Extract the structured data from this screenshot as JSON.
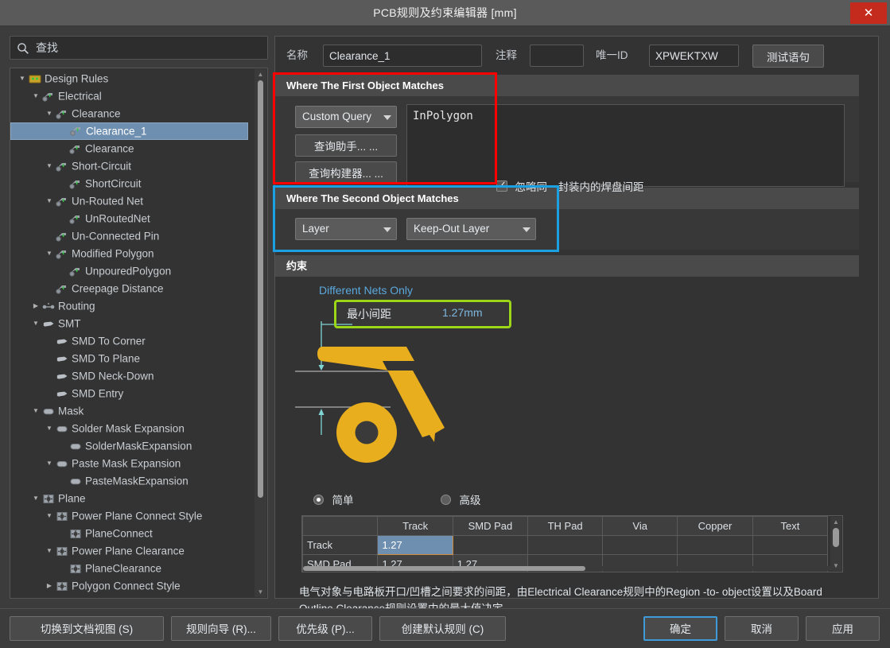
{
  "window": {
    "title": "PCB规则及约束编辑器 [mm]",
    "close_label": "✕"
  },
  "search": {
    "placeholder": "查找",
    "value": "",
    "icon": "search-icon"
  },
  "tree": {
    "items": [
      {
        "label": "Design Rules",
        "indent": 0,
        "arrow": "down",
        "icon": "folder-rules-icon",
        "selected": false
      },
      {
        "label": "Electrical",
        "indent": 1,
        "arrow": "down",
        "icon": "electrical-icon",
        "selected": false
      },
      {
        "label": "Clearance",
        "indent": 2,
        "arrow": "down",
        "icon": "electrical-icon",
        "selected": false
      },
      {
        "label": "Clearance_1",
        "indent": 3,
        "arrow": "none",
        "icon": "electrical-icon",
        "selected": true
      },
      {
        "label": "Clearance",
        "indent": 3,
        "arrow": "none",
        "icon": "electrical-icon",
        "selected": false
      },
      {
        "label": "Short-Circuit",
        "indent": 2,
        "arrow": "down",
        "icon": "electrical-icon",
        "selected": false
      },
      {
        "label": "ShortCircuit",
        "indent": 3,
        "arrow": "none",
        "icon": "electrical-icon",
        "selected": false
      },
      {
        "label": "Un-Routed Net",
        "indent": 2,
        "arrow": "down",
        "icon": "electrical-icon",
        "selected": false
      },
      {
        "label": "UnRoutedNet",
        "indent": 3,
        "arrow": "none",
        "icon": "electrical-icon",
        "selected": false
      },
      {
        "label": "Un-Connected Pin",
        "indent": 2,
        "arrow": "none",
        "icon": "electrical-icon",
        "selected": false
      },
      {
        "label": "Modified Polygon",
        "indent": 2,
        "arrow": "down",
        "icon": "electrical-icon",
        "selected": false
      },
      {
        "label": "UnpouredPolygon",
        "indent": 3,
        "arrow": "none",
        "icon": "electrical-icon",
        "selected": false
      },
      {
        "label": "Creepage Distance",
        "indent": 2,
        "arrow": "none",
        "icon": "electrical-icon",
        "selected": false
      },
      {
        "label": "Routing",
        "indent": 1,
        "arrow": "right",
        "icon": "routing-icon",
        "selected": false
      },
      {
        "label": "SMT",
        "indent": 1,
        "arrow": "down",
        "icon": "smt-icon",
        "selected": false
      },
      {
        "label": "SMD To Corner",
        "indent": 2,
        "arrow": "none",
        "icon": "smt-icon",
        "selected": false
      },
      {
        "label": "SMD To Plane",
        "indent": 2,
        "arrow": "none",
        "icon": "smt-icon",
        "selected": false
      },
      {
        "label": "SMD Neck-Down",
        "indent": 2,
        "arrow": "none",
        "icon": "smt-icon",
        "selected": false
      },
      {
        "label": "SMD Entry",
        "indent": 2,
        "arrow": "none",
        "icon": "smt-icon",
        "selected": false
      },
      {
        "label": "Mask",
        "indent": 1,
        "arrow": "down",
        "icon": "mask-icon",
        "selected": false
      },
      {
        "label": "Solder Mask Expansion",
        "indent": 2,
        "arrow": "down",
        "icon": "mask-icon",
        "selected": false
      },
      {
        "label": "SolderMaskExpansion",
        "indent": 3,
        "arrow": "none",
        "icon": "mask-icon",
        "selected": false
      },
      {
        "label": "Paste Mask Expansion",
        "indent": 2,
        "arrow": "down",
        "icon": "mask-icon",
        "selected": false
      },
      {
        "label": "PasteMaskExpansion",
        "indent": 3,
        "arrow": "none",
        "icon": "mask-icon",
        "selected": false
      },
      {
        "label": "Plane",
        "indent": 1,
        "arrow": "down",
        "icon": "plane-icon",
        "selected": false
      },
      {
        "label": "Power Plane Connect Style",
        "indent": 2,
        "arrow": "down",
        "icon": "plane-icon",
        "selected": false
      },
      {
        "label": "PlaneConnect",
        "indent": 3,
        "arrow": "none",
        "icon": "plane-icon",
        "selected": false
      },
      {
        "label": "Power Plane Clearance",
        "indent": 2,
        "arrow": "down",
        "icon": "plane-icon",
        "selected": false
      },
      {
        "label": "PlaneClearance",
        "indent": 3,
        "arrow": "none",
        "icon": "plane-icon",
        "selected": false
      },
      {
        "label": "Polygon Connect Style",
        "indent": 2,
        "arrow": "right",
        "icon": "plane-icon",
        "selected": false
      }
    ]
  },
  "rule_header": {
    "name_label": "名称",
    "name_value": "Clearance_1",
    "comment_label": "注释",
    "comment_value": "",
    "unique_id_label": "唯一ID",
    "unique_id_value": "XPWEKTXW",
    "test_query_button": "测试语句"
  },
  "first_object": {
    "section_title": "Where The First Object Matches",
    "scope_combo": "Custom Query",
    "query_helper_button": "查询助手... ...",
    "query_builder_button": "查询构建器... ...",
    "query_text": "InPolygon"
  },
  "second_object": {
    "section_title": "Where The Second Object Matches",
    "scope_combo": "Layer",
    "layer_combo": "Keep-Out Layer"
  },
  "constraints": {
    "section_title": "约束",
    "nets_scope_label": "Different Nets Only",
    "min_clearance_label": "最小间距",
    "min_clearance_value": "1.27mm",
    "ignore_pad_checkbox_label": "忽略同一封装内的焊盘间距",
    "ignore_pad_checked": true,
    "mode_simple_label": "简单",
    "mode_advanced_label": "高级",
    "mode_selected": "简单"
  },
  "matrix": {
    "columns": [
      "",
      "Track",
      "SMD Pad",
      "TH Pad",
      "Via",
      "Copper",
      "Text"
    ],
    "rows": [
      {
        "header": "Track",
        "cells": [
          "1.27",
          "",
          "",
          "",
          "",
          ""
        ],
        "selected_cell": 0
      },
      {
        "header": "SMD Pad",
        "cells": [
          "1.27",
          "1.27",
          "",
          "",
          "",
          ""
        ],
        "selected_cell": -1
      }
    ]
  },
  "description": "电气对象与电路板开口/凹槽之间要求的间距，由Electrical Clearance规则中的Region -to- object设置以及Board Outline Clearance规则设置中的最大值决定.",
  "footer": {
    "doc_view_button": "切换到文档视图 (S)",
    "rule_wizard_button": "规则向导 (R)...",
    "priority_button": "优先级 (P)...",
    "create_default_button": "创建默认规则 (C)",
    "ok_button": "确定",
    "cancel_button": "取消",
    "apply_button": "应用"
  },
  "highlights": {
    "red": "#ff0000",
    "blue": "#1ba1e2",
    "green": "#9bd619"
  }
}
